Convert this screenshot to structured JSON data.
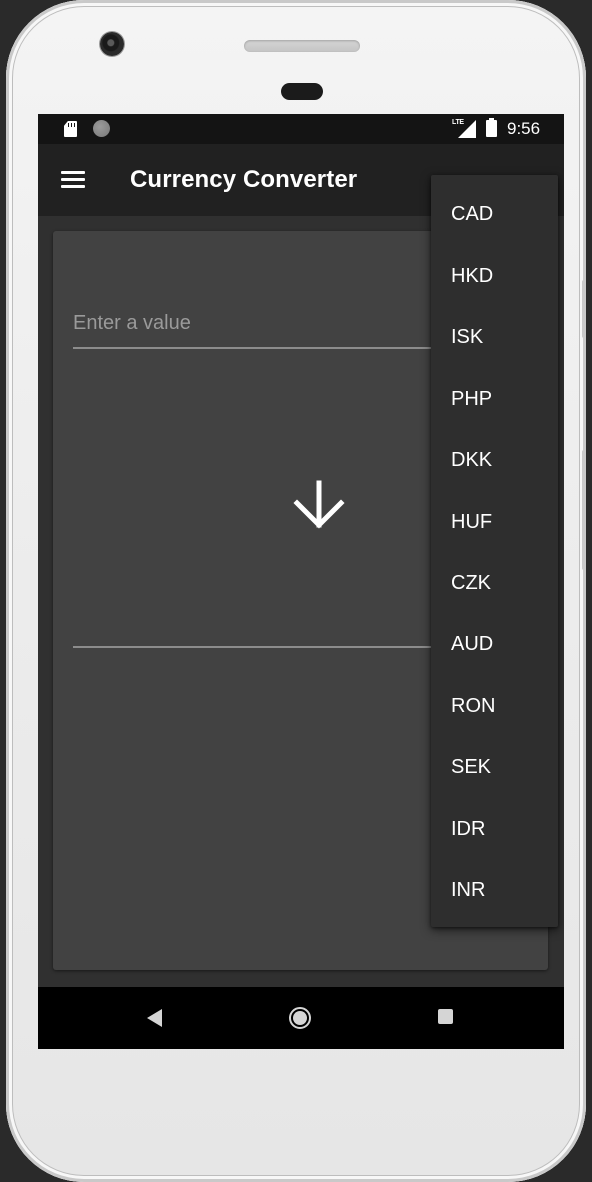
{
  "status_bar": {
    "time": "9:56",
    "network_label": "LTE",
    "icons": [
      "sd-card-icon",
      "circle-icon",
      "lte-signal-icon",
      "battery-icon"
    ]
  },
  "app_bar": {
    "title": "Currency Converter",
    "menu_icon": "menu-icon"
  },
  "converter": {
    "input_placeholder": "Enter a value",
    "input_value": "",
    "convert_icon": "arrow-down-icon",
    "output_value": ""
  },
  "currency_dropdown": {
    "items": [
      "CAD",
      "HKD",
      "ISK",
      "PHP",
      "DKK",
      "HUF",
      "CZK",
      "AUD",
      "RON",
      "SEK",
      "IDR",
      "INR"
    ]
  },
  "nav_bar": {
    "icons": [
      "back-icon",
      "home-icon",
      "recent-apps-icon"
    ]
  },
  "colors": {
    "background": "#303030",
    "app_bar": "#212121",
    "card": "#424242",
    "dropdown": "#2e2e2e",
    "text": "#ffffff",
    "hint": "#9a9a9a"
  }
}
